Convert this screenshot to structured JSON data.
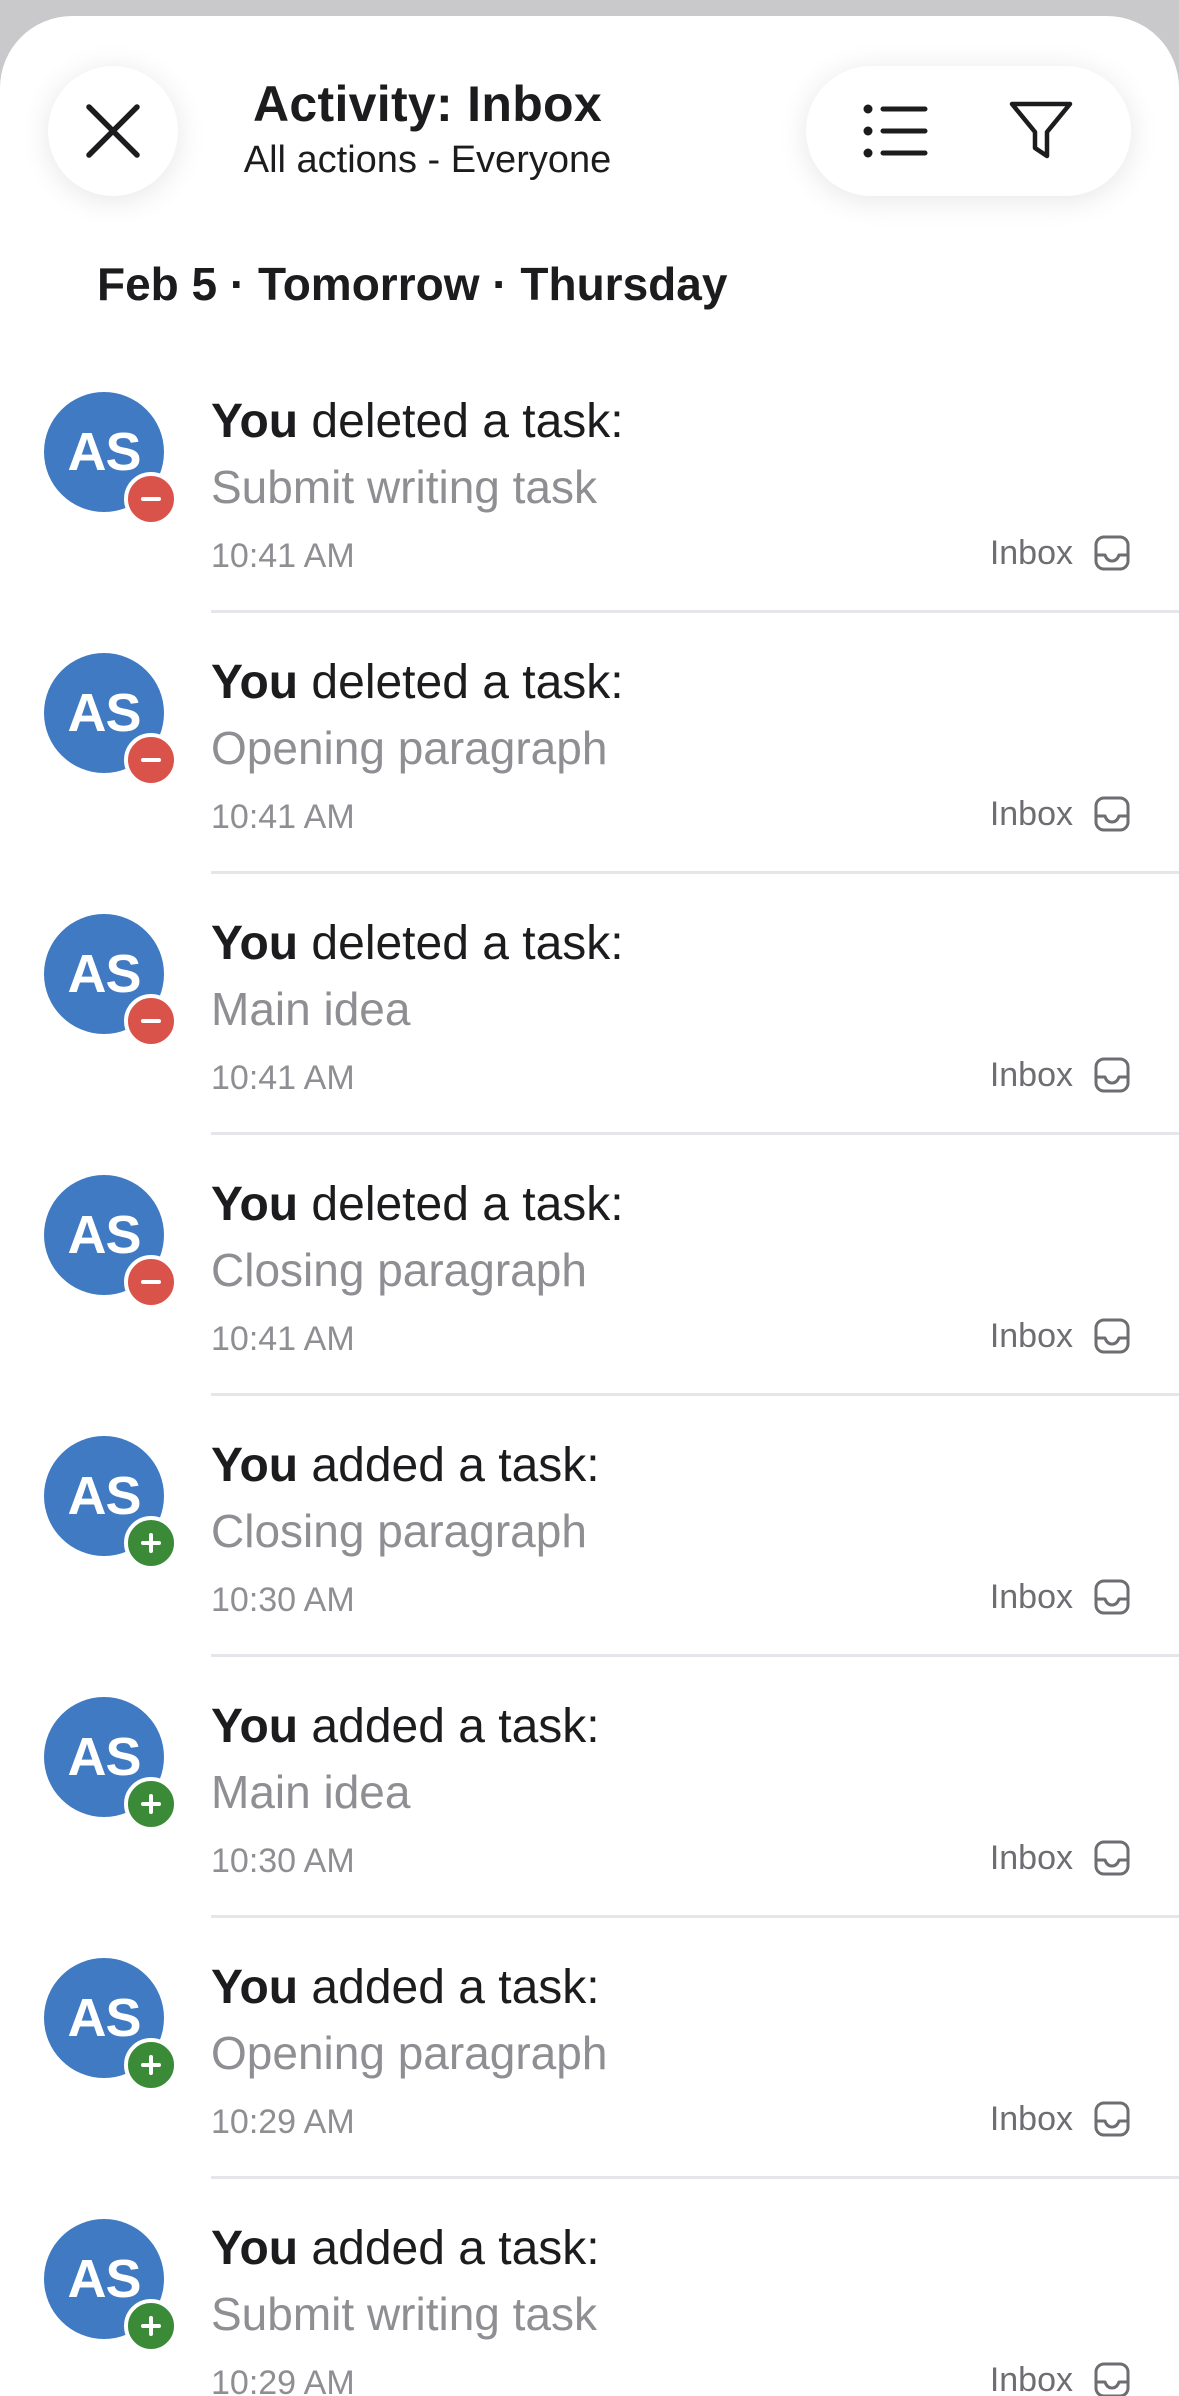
{
  "header": {
    "title": "Activity: Inbox",
    "subtitle": "All actions - Everyone"
  },
  "date_heading": "Feb 5 · Tomorrow · Thursday",
  "items": [
    {
      "actor": "You",
      "action": " deleted a task:",
      "task": "Submit writing task",
      "time": "10:41 AM",
      "project": "Inbox",
      "initials": "AS",
      "type": "deleted"
    },
    {
      "actor": "You",
      "action": " deleted a task:",
      "task": "Opening paragraph",
      "time": "10:41 AM",
      "project": "Inbox",
      "initials": "AS",
      "type": "deleted"
    },
    {
      "actor": "You",
      "action": " deleted a task:",
      "task": "Main idea",
      "time": "10:41 AM",
      "project": "Inbox",
      "initials": "AS",
      "type": "deleted"
    },
    {
      "actor": "You",
      "action": " deleted a task:",
      "task": "Closing paragraph",
      "time": "10:41 AM",
      "project": "Inbox",
      "initials": "AS",
      "type": "deleted"
    },
    {
      "actor": "You",
      "action": " added a task:",
      "task": "Closing paragraph",
      "time": "10:30 AM",
      "project": "Inbox",
      "initials": "AS",
      "type": "added"
    },
    {
      "actor": "You",
      "action": " added a task:",
      "task": "Main idea",
      "time": "10:30 AM",
      "project": "Inbox",
      "initials": "AS",
      "type": "added"
    },
    {
      "actor": "You",
      "action": " added a task:",
      "task": "Opening paragraph",
      "time": "10:29 AM",
      "project": "Inbox",
      "initials": "AS",
      "type": "added"
    },
    {
      "actor": "You",
      "action": " added a task:",
      "task": "Submit writing task",
      "time": "10:29 AM",
      "project": "Inbox",
      "initials": "AS",
      "type": "added"
    }
  ],
  "colors": {
    "avatar": "#3f7ac2",
    "deleted_badge": "#d9534a",
    "added_badge": "#3a8a38"
  },
  "icons": {
    "close": "close-icon",
    "list": "list-icon",
    "filter": "filter-icon",
    "inbox": "inbox-icon"
  }
}
